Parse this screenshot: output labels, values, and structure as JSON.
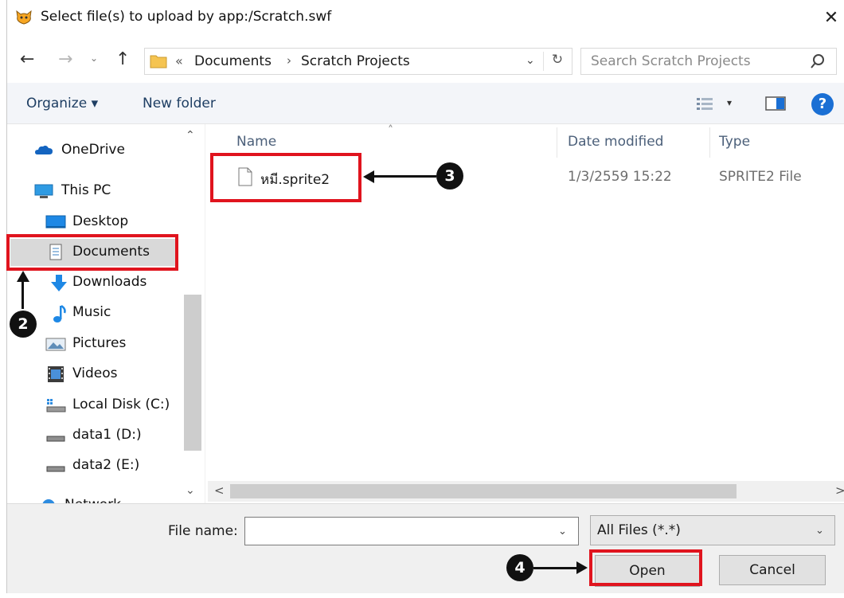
{
  "window": {
    "title": "Select file(s) to upload by app:/Scratch.swf",
    "close_glyph": "✕"
  },
  "nav": {
    "back_glyph": "←",
    "forward_glyph": "→",
    "recent_glyph": "⌄",
    "up_glyph": "↑"
  },
  "address": {
    "overflow_glyph": "«",
    "crumbs": [
      "Documents",
      "Scratch Projects"
    ],
    "separator": "›",
    "dropdown_glyph": "⌄",
    "refresh_glyph": "↻"
  },
  "search": {
    "placeholder": "Search Scratch Projects"
  },
  "toolbar": {
    "organize_label": "Organize ▾",
    "new_folder_label": "New folder",
    "view_caret": "▾",
    "help_label": "?"
  },
  "sidebar": {
    "items": [
      {
        "label": "OneDrive",
        "icon": "cloud-icon"
      },
      {
        "label": "This PC",
        "icon": "computer-icon"
      },
      {
        "label": "Desktop",
        "icon": "desktop-icon"
      },
      {
        "label": "Documents",
        "icon": "documents-icon",
        "selected": true
      },
      {
        "label": "Downloads",
        "icon": "downloads-icon"
      },
      {
        "label": "Music",
        "icon": "music-icon"
      },
      {
        "label": "Pictures",
        "icon": "pictures-icon"
      },
      {
        "label": "Videos",
        "icon": "videos-icon"
      },
      {
        "label": "Local Disk (C:)",
        "icon": "local-disk-icon"
      },
      {
        "label": "data1 (D:)",
        "icon": "drive-icon"
      },
      {
        "label": "data2 (E:)",
        "icon": "drive-icon"
      },
      {
        "label": "Network",
        "icon": "network-icon"
      }
    ],
    "scroll_up_glyph": "⌃",
    "scroll_down_glyph": "⌄"
  },
  "filelist": {
    "sort_glyph": "˄",
    "columns": [
      "Name",
      "Date modified",
      "Type"
    ],
    "rows": [
      {
        "name": "หมี.sprite2",
        "date": "1/3/2559 15:22",
        "type": "SPRITE2 File"
      }
    ],
    "scroll_left_glyph": "<",
    "scroll_right_glyph": ">"
  },
  "bottom": {
    "filename_label": "File name:",
    "filename_value": "",
    "filename_caret": "⌄",
    "filter_value": "All Files (*.*)",
    "filter_caret": "⌄",
    "open_label": "Open",
    "cancel_label": "Cancel"
  },
  "annotations": {
    "markers": [
      "2",
      "3",
      "4"
    ],
    "highlight_color": "#e0141e"
  },
  "colors": {
    "toolbar_bg": "#f3f5f9",
    "accent_blue": "#1a6fd4",
    "link_text": "#1e3e63"
  }
}
